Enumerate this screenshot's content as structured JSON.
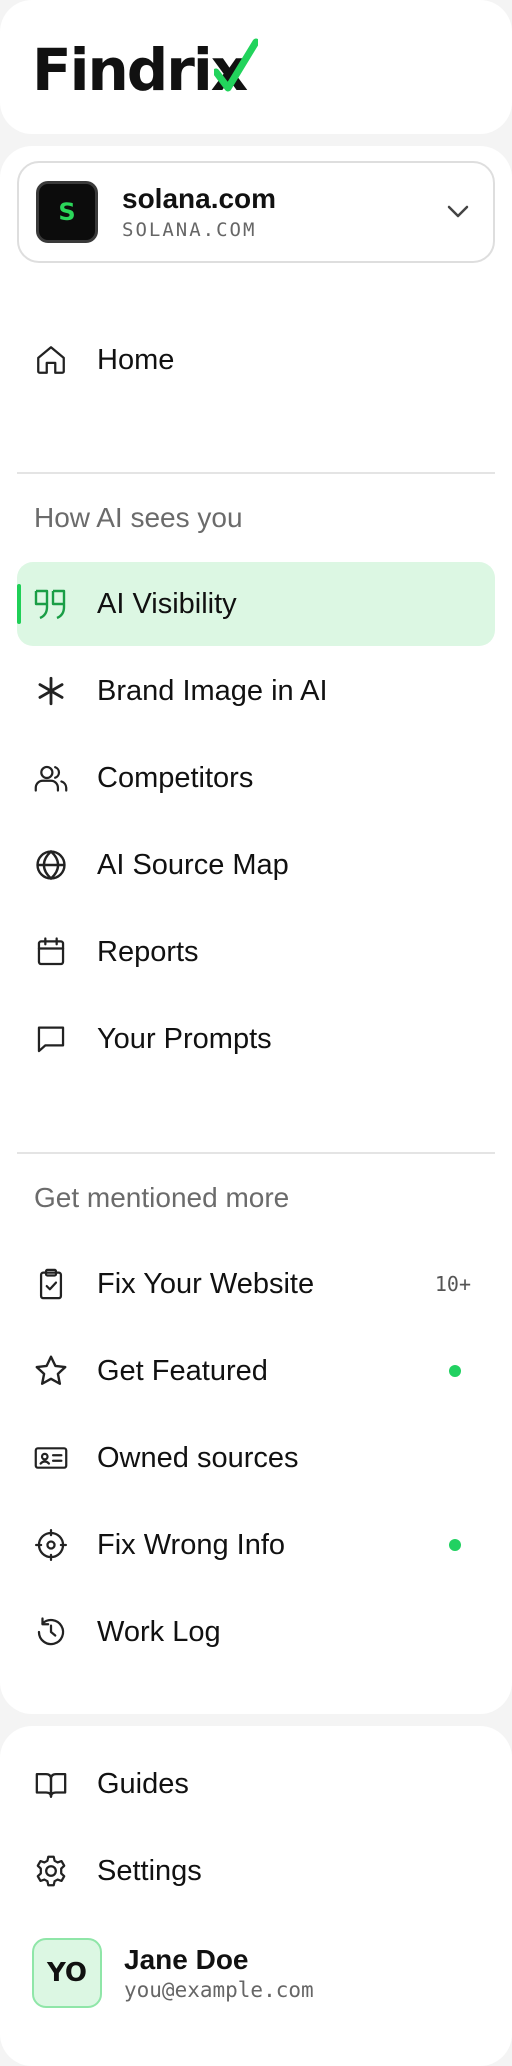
{
  "brand": {
    "name": "Findrix",
    "accent": "#22d35c"
  },
  "site": {
    "avatar_letter": "S",
    "name": "solana.com",
    "domain": "SOLANA.COM"
  },
  "nav": {
    "home": {
      "label": "Home",
      "icon": "home-icon"
    },
    "section_1": {
      "title": "How AI sees you",
      "items": [
        {
          "label": "AI Visibility",
          "icon": "quote-icon",
          "active": true
        },
        {
          "label": "Brand Image in AI",
          "icon": "asterisk-icon"
        },
        {
          "label": "Competitors",
          "icon": "users-icon"
        },
        {
          "label": "AI Source Map",
          "icon": "globe-icon"
        },
        {
          "label": "Reports",
          "icon": "calendar-icon"
        },
        {
          "label": "Your Prompts",
          "icon": "message-square-icon"
        }
      ]
    },
    "section_2": {
      "title": "Get mentioned more",
      "items": [
        {
          "label": "Fix Your Website",
          "icon": "clipboard-check-icon",
          "badge": "10+"
        },
        {
          "label": "Get Featured",
          "icon": "star-icon",
          "dot": true
        },
        {
          "label": "Owned sources",
          "icon": "id-card-icon"
        },
        {
          "label": "Fix Wrong Info",
          "icon": "target-icon",
          "dot": true
        },
        {
          "label": "Work Log",
          "icon": "history-icon"
        }
      ]
    }
  },
  "footer": {
    "items": [
      {
        "label": "Guides",
        "icon": "book-icon"
      },
      {
        "label": "Settings",
        "icon": "gear-icon"
      }
    ],
    "user": {
      "initials": "YO",
      "name": "Jane Doe",
      "email": "you@example.com"
    }
  }
}
